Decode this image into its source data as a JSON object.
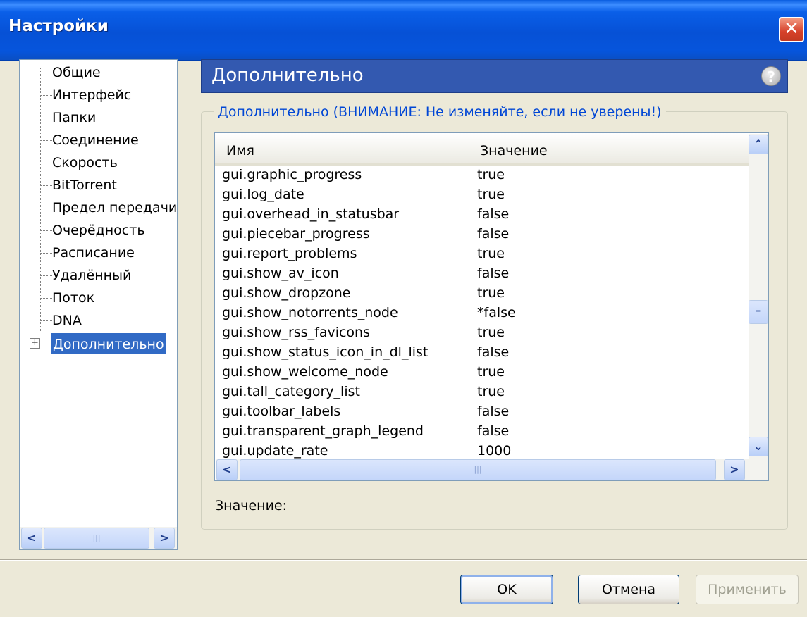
{
  "window": {
    "title": "Настройки",
    "close_label": "✕"
  },
  "sidebar": {
    "items": [
      {
        "label": "Общие"
      },
      {
        "label": "Интерфейс"
      },
      {
        "label": "Папки"
      },
      {
        "label": "Соединение"
      },
      {
        "label": "Скорость"
      },
      {
        "label": "BitTorrent"
      },
      {
        "label": "Предел передачи"
      },
      {
        "label": "Очерёдность"
      },
      {
        "label": "Расписание"
      },
      {
        "label": "Удалённый"
      },
      {
        "label": "Поток"
      },
      {
        "label": "DNA"
      },
      {
        "label": "Дополнительно",
        "selected": true,
        "expander": "+"
      }
    ]
  },
  "main": {
    "header_title": "Дополнительно",
    "help_label": "?",
    "group_title": "Дополнительно (ВНИМАНИЕ: Не изменяйте, если не уверены!)",
    "table": {
      "columns": [
        "Имя",
        "Значение"
      ],
      "rows": [
        {
          "name": "gui.graphic_progress",
          "value": "true"
        },
        {
          "name": "gui.log_date",
          "value": "true"
        },
        {
          "name": "gui.overhead_in_statusbar",
          "value": "false"
        },
        {
          "name": "gui.piecebar_progress",
          "value": "false"
        },
        {
          "name": "gui.report_problems",
          "value": "true"
        },
        {
          "name": "gui.show_av_icon",
          "value": "false"
        },
        {
          "name": "gui.show_dropzone",
          "value": "true"
        },
        {
          "name": "gui.show_notorrents_node",
          "value": "*false"
        },
        {
          "name": "gui.show_rss_favicons",
          "value": "true"
        },
        {
          "name": "gui.show_status_icon_in_dl_list",
          "value": "false"
        },
        {
          "name": "gui.show_welcome_node",
          "value": "true"
        },
        {
          "name": "gui.tall_category_list",
          "value": "true"
        },
        {
          "name": "gui.toolbar_labels",
          "value": "false"
        },
        {
          "name": "gui.transparent_graph_legend",
          "value": "false"
        },
        {
          "name": "gui.update_rate",
          "value": "1000"
        }
      ]
    },
    "value_label": "Значение:"
  },
  "footer": {
    "ok_label": "OK",
    "cancel_label": "Отмена",
    "apply_label": "Применить"
  }
}
